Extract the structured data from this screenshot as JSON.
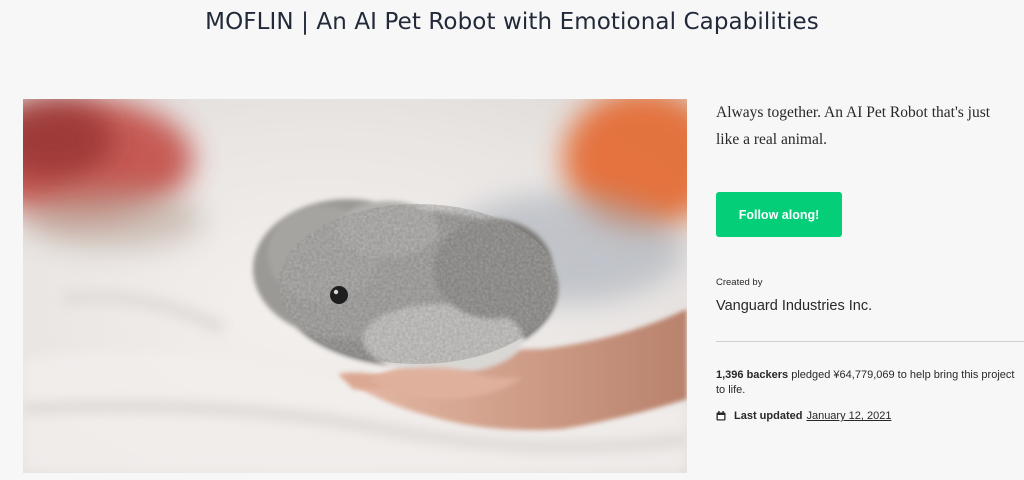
{
  "project": {
    "title": "MOFLIN | An AI Pet Robot with Emotional Capabilities",
    "tagline": "Always together. An AI Pet Robot that's just like a real animal.",
    "follow_button_label": "Follow along!",
    "created_by_label": "Created by",
    "creator_name": "Vanguard Industries Inc.",
    "backers_count": "1,396 backers",
    "pledged_text": " pledged ¥64,779,069 to help bring this project to life.",
    "last_updated_label": "Last updated",
    "last_updated_date": "January 12, 2021"
  },
  "icons": {
    "calendar": "calendar-icon"
  },
  "colors": {
    "accent_green": "#05ce78",
    "text_dark": "#282828",
    "page_background": "#f7f7f8"
  }
}
